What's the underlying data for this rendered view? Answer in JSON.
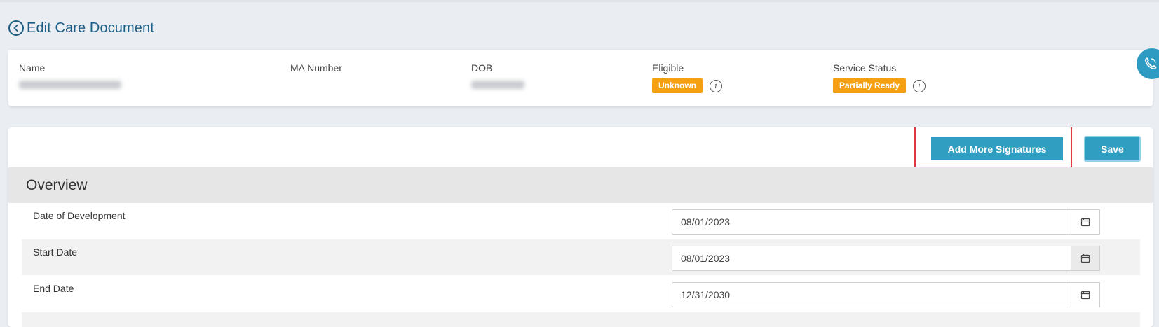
{
  "header": {
    "title": "Edit Care Document"
  },
  "client": {
    "name_label": "Name",
    "ma_label": "MA Number",
    "dob_label": "DOB",
    "eligible_label": "Eligible",
    "eligible_value": "Unknown",
    "service_status_label": "Service Status",
    "service_status_value": "Partially Ready"
  },
  "actions": {
    "add_signatures_label": "Add More Signatures",
    "save_label": "Save"
  },
  "overview": {
    "title": "Overview",
    "fields": [
      {
        "label": "Date of Development",
        "value": "08/01/2023"
      },
      {
        "label": "Start Date",
        "value": "08/01/2023"
      },
      {
        "label": "End Date",
        "value": "12/31/2030"
      }
    ]
  },
  "icons": {
    "back": "chevron-left-circle-icon",
    "info": "info-icon",
    "calendar": "calendar-icon",
    "phone": "phone-icon"
  },
  "colors": {
    "title": "#1e5f86",
    "badge": "#f5a012",
    "button": "#2f9ec1",
    "highlight": "#e0383e"
  }
}
